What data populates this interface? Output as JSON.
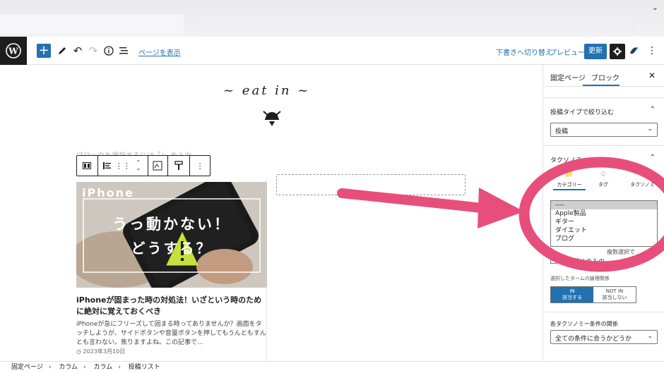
{
  "toolbar": {
    "view_page": "ページを表示",
    "switch_draft": "下書きへ切り替え",
    "preview": "プレビュー",
    "update": "更新"
  },
  "canvas": {
    "logo_text": "~ eat in ~",
    "placeholder": "ブロックを選択するには「/」を入力",
    "post": {
      "image_word": "iPhone",
      "image_line1": "うっ動かない！",
      "image_line2": "どうする？",
      "title": "iPhoneが固まった時の対処法！いざという時のために絶対に覚えておくべき",
      "excerpt": "iPhoneが急にフリーズして固まる時ってありませんか？画面をタッチしようが、サイドボタンや音量ボタンを押してもうんともすんとも言わない。焦りますよね。この記事で...",
      "date": "2023年3月10日"
    }
  },
  "sidebar": {
    "tab_page": "固定ページ",
    "tab_block": "ブロック",
    "post_type_label": "投稿タイプで絞り込む",
    "post_type_value": "投稿",
    "taxonomy_label": "タクソノミー",
    "tax_tabs": [
      "カテゴリー",
      "タグ",
      "タクソノミー"
    ],
    "terms": [
      "----",
      "Apple製品",
      "ギター",
      "ダイエット",
      "ブログ"
    ],
    "multi_select_note": "複数選択で",
    "only_child_label": "カテゴリのみの",
    "relation_label": "選択したタームの論理関係",
    "relation_in": "IN",
    "relation_in_sub": "該当する",
    "relation_not_in": "NOT IN",
    "relation_not_in_sub": "該当しない",
    "cond_label": "各タクソノミー条件の関係",
    "cond_value": "全ての条件に合うかどうか"
  },
  "breadcrumb": [
    "固定ページ",
    "カラム",
    "カラム",
    "投稿リスト"
  ],
  "colors": {
    "accent": "#2271b1",
    "annotation": "#e84e7c"
  }
}
